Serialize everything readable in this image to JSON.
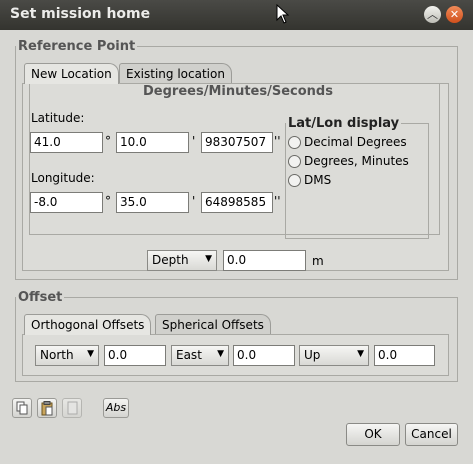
{
  "window": {
    "title": "Set mission home"
  },
  "reference": {
    "legend": "Reference Point",
    "tabs": [
      "New Location",
      "Existing location"
    ],
    "section_title": "Degrees/Minutes/Seconds",
    "latitude": {
      "label": "Latitude:",
      "deg": "41.0",
      "deg_sym": "°",
      "min": "10.0",
      "min_sym": "'",
      "sec": "98307507",
      "sec_sym": "''"
    },
    "longitude": {
      "label": "Longitude:",
      "deg": "-8.0",
      "deg_sym": "°",
      "min": "35.0",
      "min_sym": "'",
      "sec": "64898585",
      "sec_sym": "''"
    },
    "latlon_display": {
      "title": "Lat/Lon display",
      "options": [
        "Decimal Degrees",
        "Degrees, Minutes",
        "DMS"
      ]
    },
    "depth": {
      "mode": "Depth",
      "value": "0.0",
      "unit": "m"
    }
  },
  "offset": {
    "legend": "Offset",
    "tabs": [
      "Orthogonal Offsets",
      "Spherical Offsets"
    ],
    "north": {
      "dir": "North",
      "value": "0.0"
    },
    "east": {
      "dir": "East",
      "value": "0.0"
    },
    "up": {
      "dir": "Up",
      "value": "0.0"
    }
  },
  "toolbar": {
    "abs_label": "Abs"
  },
  "buttons": {
    "ok": "OK",
    "cancel": "Cancel"
  },
  "icons": [
    "copy-icon",
    "paste-icon",
    "clear-icon"
  ]
}
